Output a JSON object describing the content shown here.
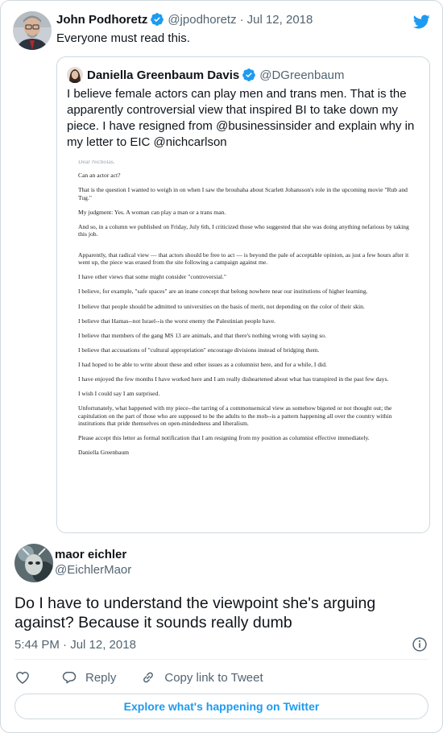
{
  "parent_tweet": {
    "author_name": "John Podhoretz",
    "handle": "@jpodhoretz",
    "separator": "·",
    "date": "Jul 12, 2018",
    "text": "Everyone must read this."
  },
  "quoted_tweet": {
    "author_name": "Daniella Greenbaum Davis",
    "handle": "@DGreenbaum",
    "text": "I believe female actors can play men and trans men. That is the apparently controversial view that inspired BI to take down my piece. I have resigned from @businessinsider and explain why in my letter to EIC @nichcarlson",
    "letter": {
      "cut_line": "Dear Nicholas,",
      "paragraphs": [
        "Can an actor act?",
        "That is the question I wanted to weigh in on when I saw the brouhaha about Scarlett Johansson's role in the upcoming movie \"Rub and Tug.\"",
        "My judgment: Yes. A woman can play a man or a trans man.",
        "And so, in a column we published on Friday, July 6th, I criticized those who suggested that she was doing anything nefarious by taking this job.",
        "Apparently, that radical view — that actors should be free to act — is beyond the pale of acceptable opinion, as just a few hours after it went up, the piece was erased from the site following a campaign against me.",
        "I have other views that some might consider \"controversial.\"",
        "I believe, for example, \"safe spaces\" are an inane concept that belong nowhere near our institutions of higher learning.",
        "I believe that people should be admitted to universities on the basis of merit, not depending on the color of their skin.",
        "I believe that Hamas--not Israel--is the worst enemy the Palestinian people have.",
        "I believe that members of the gang MS 13 are animals, and that there's nothing wrong with saying so.",
        "I believe that accusations of \"cultural appropriation\" encourage divisions instead of bridging them.",
        "I had hoped to be able to write about these and other issues as a columnist here, and for a while, I did.",
        "I have enjoyed the few months I have worked here and I am really disheartened about what has transpired in the past few days.",
        "I wish I could say I am surprised.",
        "Unfortunately, what happened with my piece--the tarring of a commonsensical view as somehow bigoted or not thought out; the capitulation on the part of those who are supposed to be the adults to the mob--is a pattern happening all over the country within institutions that pride themselves on open-mindedness and liberalism.",
        "Please accept this letter as formal notification that I am resigning from my position as columnist effective immediately.",
        "Daniella Greenbaum"
      ]
    }
  },
  "reply_tweet": {
    "author_name": "maor eichler",
    "handle": "@EichlerMaor",
    "text": "Do I have to understand the viewpoint she's arguing against? Because it sounds really dumb",
    "timestamp": "5:44 PM · Jul 12, 2018"
  },
  "actions": {
    "reply_label": "Reply",
    "copy_link_label": "Copy link to Tweet"
  },
  "explore_button": "Explore what's happening on Twitter",
  "icons": {
    "verified": "verified-badge-icon",
    "brand": "twitter-bird-icon",
    "like": "heart-icon",
    "reply": "speech-bubble-icon",
    "copy_link": "link-icon",
    "info": "info-icon"
  },
  "colors": {
    "accent": "#1d9bf0",
    "text": "#0f1419",
    "secondary_text": "#536471",
    "border": "#cfd9de"
  }
}
